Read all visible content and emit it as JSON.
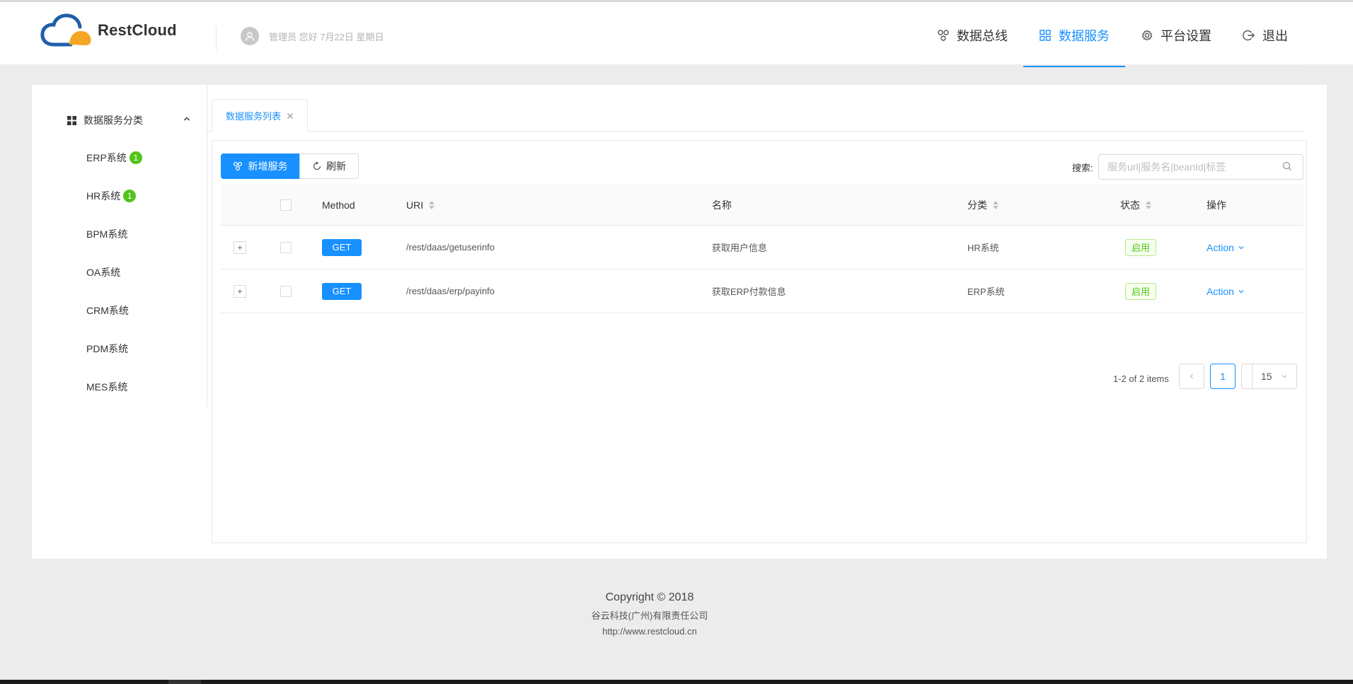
{
  "header": {
    "brand": "RestCloud",
    "user_text": "管理员 您好 7月22日 星期日",
    "nav": [
      {
        "label": "数据总线",
        "icon": "bus-icon"
      },
      {
        "label": "数据服务",
        "icon": "grid-icon",
        "active": true
      },
      {
        "label": "平台设置",
        "icon": "gear-icon"
      },
      {
        "label": "退出",
        "icon": "logout-icon"
      }
    ]
  },
  "sidebar": {
    "title": "数据服务分类",
    "items": [
      {
        "label": "ERP系统",
        "badge": "1"
      },
      {
        "label": "HR系统",
        "badge": "1"
      },
      {
        "label": "BPM系统"
      },
      {
        "label": "OA系统"
      },
      {
        "label": "CRM系统"
      },
      {
        "label": "PDM系统"
      },
      {
        "label": "MES系统"
      }
    ]
  },
  "tabs": [
    {
      "label": "数据服务列表"
    }
  ],
  "toolbar": {
    "add_label": "新增服务",
    "refresh_label": "刷新",
    "search_label": "搜索:",
    "search_placeholder": "服务url|服务名|beanId|标签"
  },
  "table": {
    "columns": [
      "Method",
      "URI",
      "名称",
      "分类",
      "状态",
      "操作"
    ],
    "rows": [
      {
        "expand": "+",
        "method": "GET",
        "uri": "/rest/daas/getuserinfo",
        "name": "获取用户信息",
        "category": "HR系统",
        "status": "启用",
        "action": "Action"
      },
      {
        "expand": "+",
        "method": "GET",
        "uri": "/rest/daas/erp/payinfo",
        "name": "获取ERP付款信息",
        "category": "ERP系统",
        "status": "启用",
        "action": "Action"
      }
    ]
  },
  "pagination": {
    "total_text": "1-2 of 2 items",
    "current_page": "1",
    "page_size": "15"
  },
  "footer": {
    "copyright": "Copyright © 2018",
    "company": "谷云科技(广州)有限责任公司",
    "url": "http://www.restcloud.cn"
  },
  "colors": {
    "primary": "#1890ff",
    "success": "#52c41a",
    "logo_blue": "#1f5fa8",
    "logo_orange": "#f5a623"
  }
}
